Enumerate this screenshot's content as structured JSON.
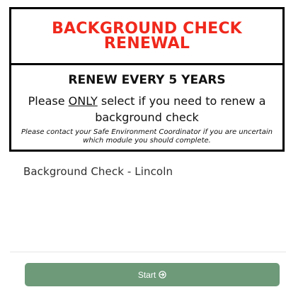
{
  "banner": {
    "title_line1": "BACKGROUND CHECK",
    "title_line2": "RENEWAL",
    "renew_text": "RENEW EVERY 5 YEARS",
    "instruction_pre": "Please ",
    "instruction_emph": "ONLY",
    "instruction_post": " select if you need to renew a background check",
    "note": "Please contact your Safe Environment Coordinator if you are uncertain which module you should complete.",
    "title_color": "#f0281c"
  },
  "module": {
    "name": "Background Check - Lincoln"
  },
  "actions": {
    "start_label": "Start",
    "start_icon": "circle-arrow-right-icon",
    "button_color": "#6e9a7a"
  }
}
